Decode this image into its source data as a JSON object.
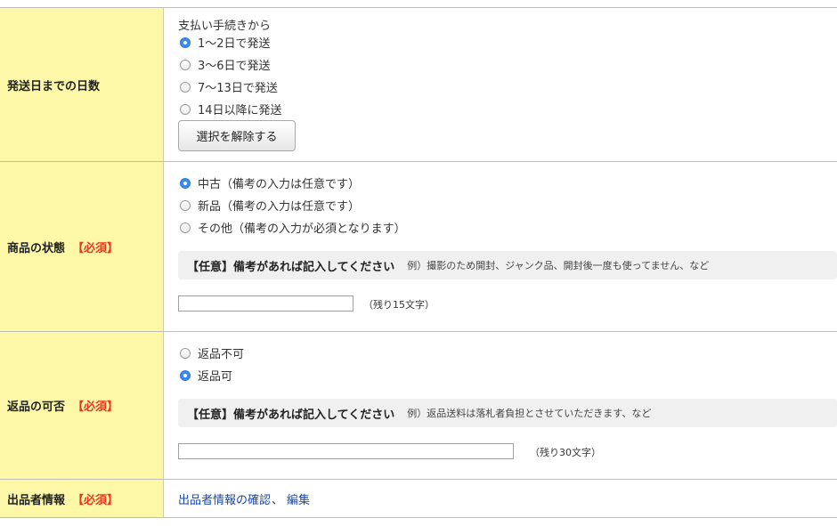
{
  "shipping_days": {
    "label": "発送日までの日数",
    "intro": "支払い手続きから",
    "options": [
      {
        "label": "1〜2日で発送",
        "checked": true
      },
      {
        "label": "3〜6日で発送",
        "checked": false
      },
      {
        "label": "7〜13日で発送",
        "checked": false
      },
      {
        "label": "14日以降に発送",
        "checked": false
      }
    ],
    "clear_button": "選択を解除する"
  },
  "condition": {
    "label": "商品の状態",
    "required": "【必須】",
    "options": [
      {
        "label": "中古（備考の入力は任意です）",
        "checked": true
      },
      {
        "label": "新品（備考の入力は任意です）",
        "checked": false
      },
      {
        "label": "その他（備考の入力が必須となります）",
        "checked": false
      }
    ],
    "note_title": "【任意】備考があれば記入してください",
    "note_example": "例）撮影のため開封、ジャンク品、開封後一度も使ってません、など",
    "input_value": "",
    "remaining": "（残り15文字）"
  },
  "returns": {
    "label": "返品の可否",
    "required": "【必須】",
    "options": [
      {
        "label": "返品不可",
        "checked": false
      },
      {
        "label": "返品可",
        "checked": true
      }
    ],
    "note_title": "【任意】備考があれば記入してください",
    "note_example": "例）返品送料は落札者負担とさせていただきます、など",
    "input_value": "",
    "remaining": "（残り30文字）"
  },
  "seller_info": {
    "label": "出品者情報",
    "required": "【必須】",
    "link_confirm": "出品者情報の確認",
    "separator": "、",
    "link_edit": "編集"
  },
  "colors": {
    "label_bg": "#fdf8a7",
    "required": "#e8381f",
    "link": "#1a48a8",
    "radio_checked": "#3b8cf1"
  }
}
